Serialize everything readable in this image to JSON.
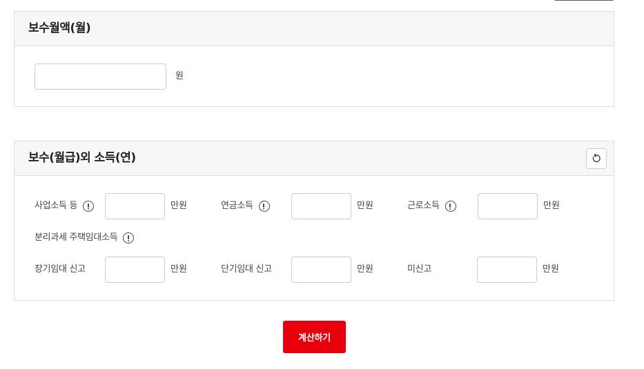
{
  "salary_section": {
    "title": "보수월액(월)",
    "salary_value": "",
    "unit": "원"
  },
  "other_income_section": {
    "title": "보수(월급)외 소득(연)",
    "reset_icon": "reset-icon",
    "fields": [
      {
        "label": "사업소득 등",
        "value": "",
        "unit": "만원",
        "has_info": true
      },
      {
        "label": "연금소득",
        "value": "",
        "unit": "만원",
        "has_info": true
      },
      {
        "label": "근로소득",
        "value": "",
        "unit": "만원",
        "has_info": true
      }
    ],
    "rental_group_label": "분리과세 주택임대소득",
    "rental_fields": [
      {
        "label": "장기임대 신고",
        "value": "",
        "unit": "만원"
      },
      {
        "label": "단기임대 신고",
        "value": "",
        "unit": "만원"
      },
      {
        "label": "미신고",
        "value": "",
        "unit": "만원"
      }
    ]
  },
  "calculate_button": {
    "label": "계산하기"
  },
  "colors": {
    "accent": "#e8000b",
    "header_bg": "#f7f7f7",
    "border": "#dddddd"
  }
}
